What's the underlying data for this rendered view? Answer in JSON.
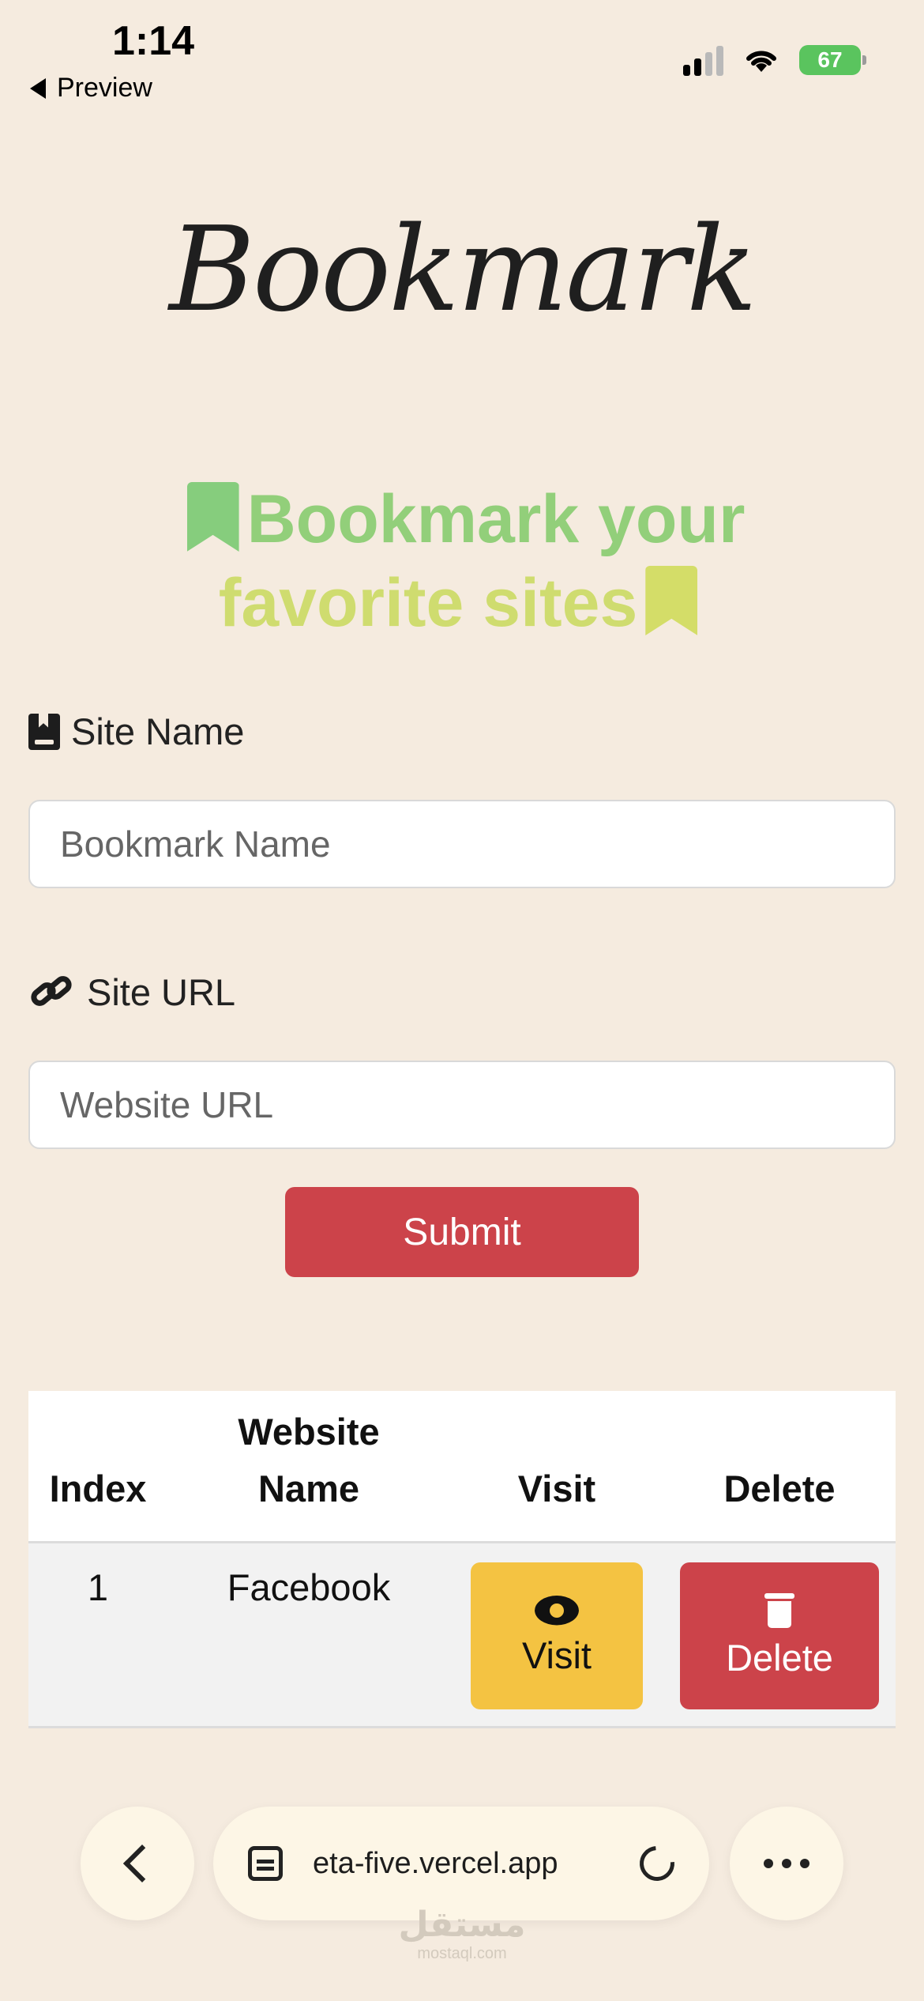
{
  "status": {
    "time": "1:14",
    "back_label": "Preview",
    "battery": "67"
  },
  "brand": "Bookmark",
  "hero": {
    "line1": "Bookmark your",
    "line2": "favorite sites"
  },
  "form": {
    "site_name_label": "Site Name",
    "site_name_placeholder": "Bookmark Name",
    "site_url_label": "Site URL",
    "site_url_placeholder": "Website URL",
    "submit_label": "Submit"
  },
  "table": {
    "headers": {
      "index": "Index",
      "name_line1": "Website",
      "name_line2": "Name",
      "visit": "Visit",
      "delete": "Delete"
    },
    "rows": [
      {
        "index": "1",
        "name": "Facebook",
        "visit_label": "Visit",
        "delete_label": "Delete"
      }
    ]
  },
  "browser": {
    "url": "eta-five.vercel.app"
  },
  "watermark": {
    "arabic": "مستقل",
    "latin": "mostaql.com"
  },
  "colors": {
    "background": "#f5ebdf",
    "danger": "#cc434a",
    "warning": "#f4c342"
  }
}
